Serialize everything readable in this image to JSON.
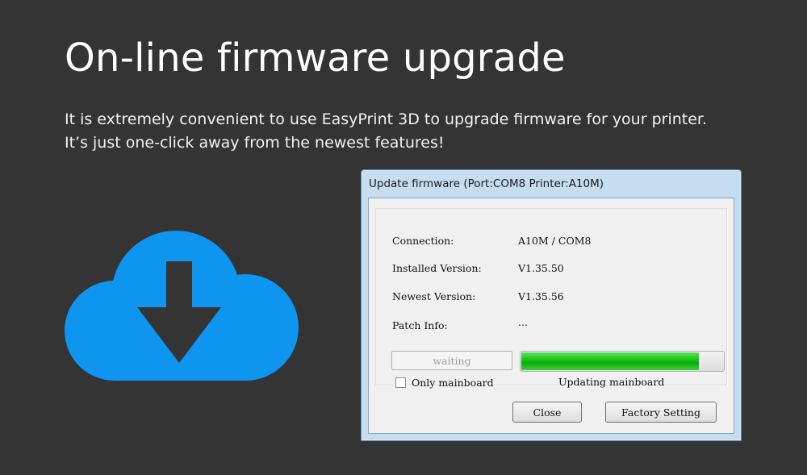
{
  "hero": {
    "title": "On-line firmware upgrade",
    "description_line1": "It is extremely convenient to use EasyPrint 3D to upgrade firmware for your printer.",
    "description_line2": "It’s just one-click away from the newest features!"
  },
  "colors": {
    "background": "#343434",
    "cloud": "#0e95f0",
    "progress_green": "#1fcb1f"
  },
  "dialog": {
    "title": "Update firmware (Port:COM8 Printer:A10M)",
    "info": [
      {
        "label": "Connection:",
        "value": "A10M / COM8"
      },
      {
        "label": "Installed Version:",
        "value": "V1.35.50"
      },
      {
        "label": "Newest Version:",
        "value": "V1.35.56"
      },
      {
        "label": "Patch Info:",
        "value": "..."
      }
    ],
    "waiting_button": "waiting",
    "only_mainboard_label": "Only mainboard",
    "only_mainboard_checked": false,
    "progress_fraction": 0.88,
    "progress_status": "Updating mainboard",
    "close_button": "Close",
    "factory_setting_button": "Factory Setting"
  }
}
